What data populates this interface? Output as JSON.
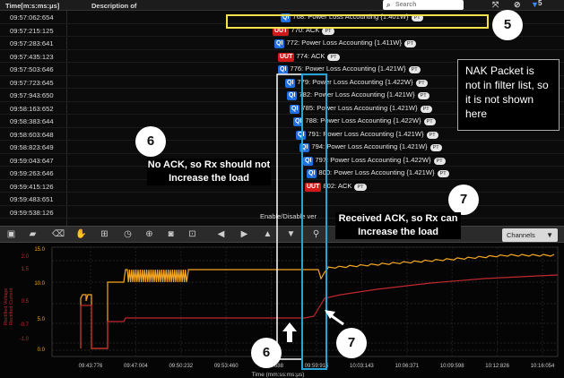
{
  "header": {
    "time_col": "Time[m:s:ms:μs]",
    "desc_col": "Description of",
    "search_placeholder": "Search",
    "filter_count": "5"
  },
  "rows": [
    {
      "time": "09:57:062:654",
      "badge": "QI",
      "badge_type": "qi",
      "text": "768: Power Loss Accounting {1.401W}",
      "pt": "PT"
    },
    {
      "time": "09:57:215:125",
      "badge": "UUT",
      "badge_type": "uut",
      "text": "770: ACK",
      "pt": "PT"
    },
    {
      "time": "09:57:283:641",
      "badge": "QI",
      "badge_type": "qi",
      "text": "772: Power Loss Accounting {1.411W}",
      "pt": "PT"
    },
    {
      "time": "09:57:435:123",
      "badge": "UUT",
      "badge_type": "uut",
      "text": "774: ACK",
      "pt": "PT"
    },
    {
      "time": "09:57:503:646",
      "badge": "QI",
      "badge_type": "qi",
      "text": "776: Power Loss Accounting {1.421W}",
      "pt": "PT"
    },
    {
      "time": "09:57:723:645",
      "badge": "QI",
      "badge_type": "qi",
      "text": "779: Power Loss Accounting {1.422W}",
      "pt": "PT"
    },
    {
      "time": "09:57:943:650",
      "badge": "QI",
      "badge_type": "qi",
      "text": "782: Power Loss Accounting {1.421W}",
      "pt": "PT"
    },
    {
      "time": "09:58:163:652",
      "badge": "QI",
      "badge_type": "qi",
      "text": "785: Power Loss Accounting {1.421W}",
      "pt": "PT"
    },
    {
      "time": "09:58:383:644",
      "badge": "QI",
      "badge_type": "qi",
      "text": "788: Power Loss Accounting {1.422W}",
      "pt": "PT"
    },
    {
      "time": "09:58:603:648",
      "badge": "QI",
      "badge_type": "qi",
      "text": "791: Power Loss Accounting {1.421W}",
      "pt": "PT"
    },
    {
      "time": "09:58:823:649",
      "badge": "QI",
      "badge_type": "qi",
      "text": "794: Power Loss Accounting {1.421W}",
      "pt": "PT"
    },
    {
      "time": "09:59:043:647",
      "badge": "QI",
      "badge_type": "qi",
      "text": "797: Power Loss Accounting {1.422W}",
      "pt": "PT"
    },
    {
      "time": "09:59:263:646",
      "badge": "QI",
      "badge_type": "qi",
      "text": "800: Power Loss Accounting {1.421W}",
      "pt": "PT"
    },
    {
      "time": "09:59:415:126",
      "badge": "UUT",
      "badge_type": "uut",
      "text": "802: ACK",
      "pt": "PT"
    },
    {
      "time": "09:59:483:651",
      "badge": "",
      "badge_type": "",
      "text": "",
      "pt": ""
    },
    {
      "time": "09:59:538:126",
      "badge": "",
      "badge_type": "",
      "text": "",
      "pt": ""
    }
  ],
  "enable_label": "Enable/Disable ver",
  "toolbar": {
    "channels_label": "Channels"
  },
  "chart_data": {
    "type": "line",
    "xlabel": "Time (mm:ss:ms:μs)",
    "x_ticks": [
      "09:43:776",
      "09:47:004",
      "09:50:232",
      "09:53:460",
      "09:56:688",
      "09:59:915",
      "10:03:143",
      "10:06:371",
      "10:09:598",
      "10:12:826",
      "10:16:054"
    ],
    "y_ticks_left": [
      "15.0",
      "10.0",
      "5.0",
      "0.0"
    ],
    "y_ticks_right": [
      "2.0",
      "1.5",
      "0.5",
      "-0.7",
      "-1.0"
    ],
    "y_labels": [
      "Rectified Voltage",
      "Rectified Current"
    ],
    "series": [
      {
        "name": "Rectified Voltage",
        "color": "#f5a623"
      },
      {
        "name": "Rectified Current",
        "color": "#c0282d"
      }
    ]
  },
  "annotations": {
    "callout_no_ack": "No ACK, so Rx should not Increase the load",
    "callout_ack": "Received ACK, so Rx can Increase the load",
    "nak_note": "NAK Packet is not in filter list, so it is not shown here",
    "num5": "5",
    "num6_top": "6",
    "num6_bottom": "6",
    "num7_top": "7",
    "num7_bottom": "7"
  }
}
